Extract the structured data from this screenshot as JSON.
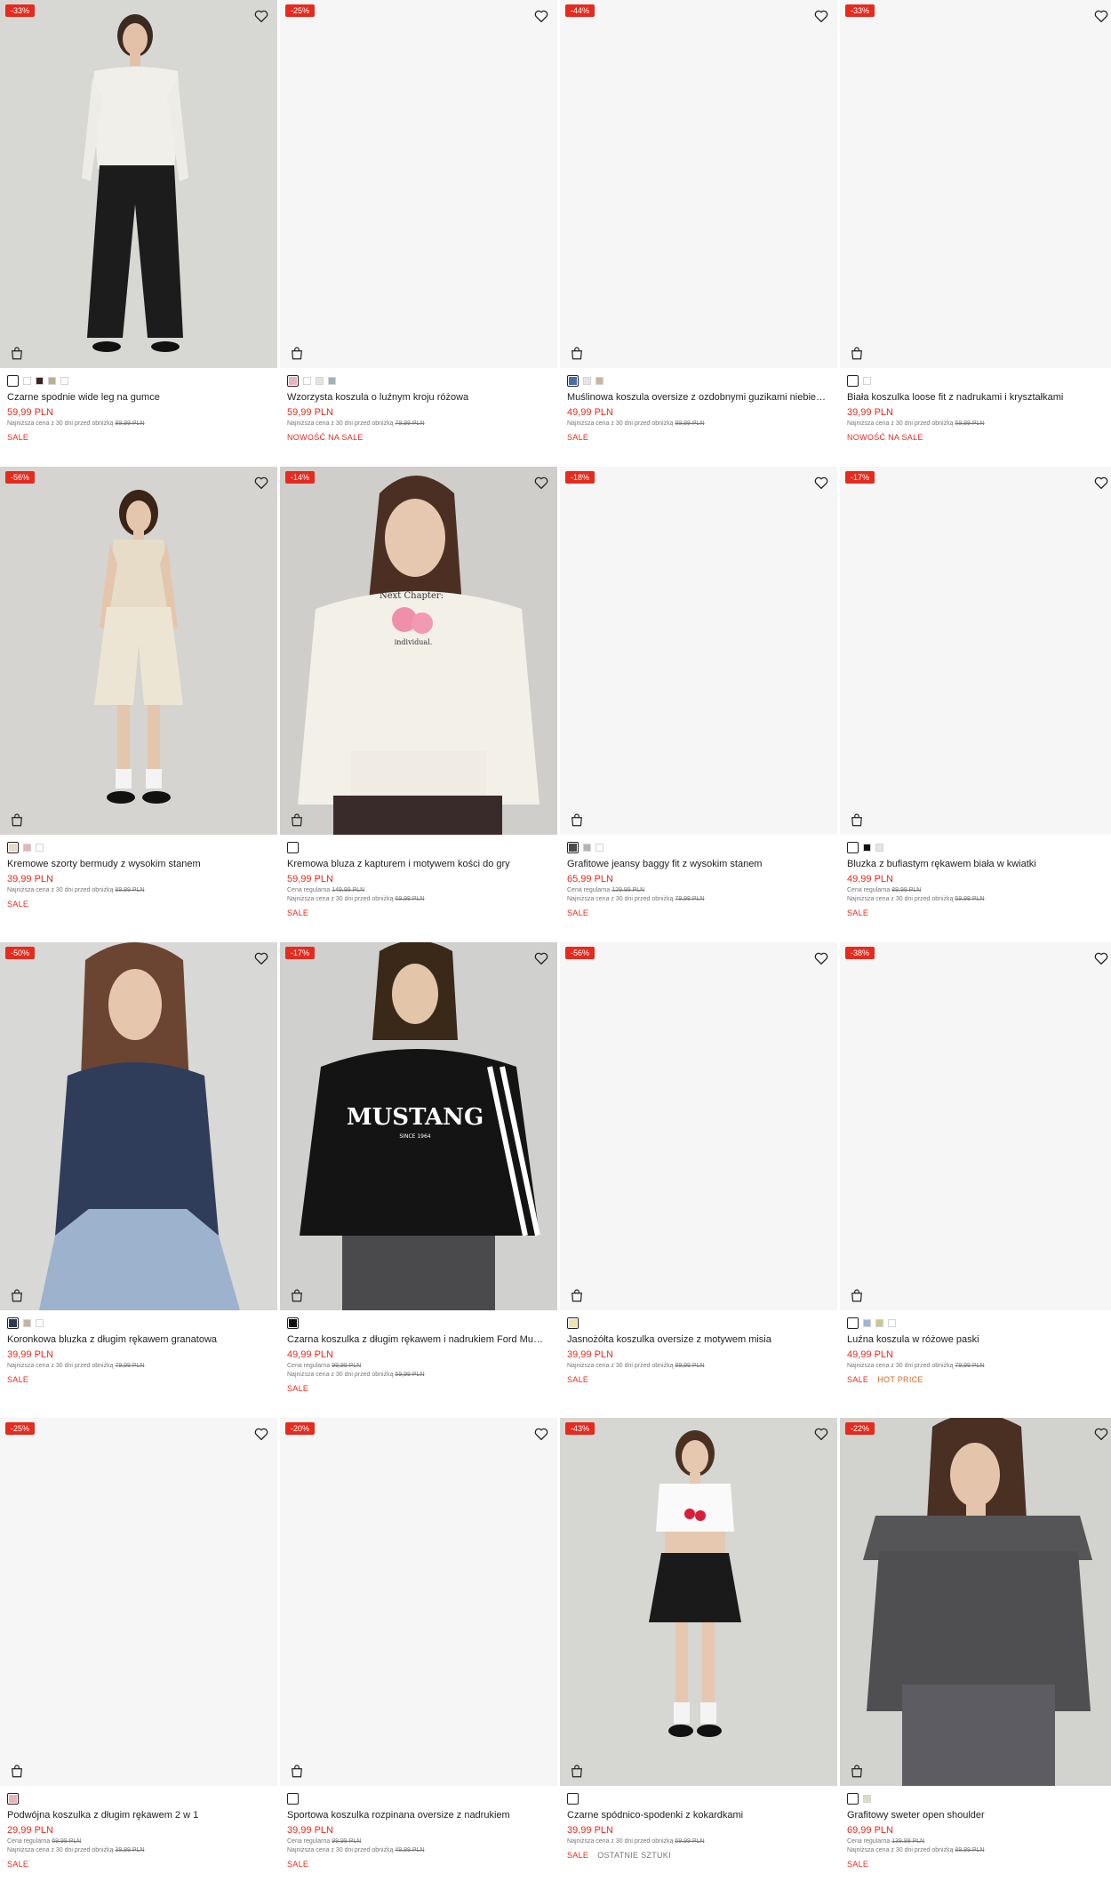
{
  "products": [
    {
      "discount": "-33%",
      "has_photo": true,
      "figure": "offshoulder_white",
      "swatches": [
        "#ffffff",
        "#ffffff",
        "#3a2520",
        "#b8b095",
        "#ffffff"
      ],
      "name": "Czarne spodnie wide leg na gumce",
      "price": "59,99 PLN",
      "regular": "",
      "lowest_label": "Najniższa cena z 30 dni przed obniżką",
      "lowest_price": "89,99 PLN",
      "tags": [
        "SALE"
      ]
    },
    {
      "discount": "-25%",
      "has_photo": false,
      "figure": "",
      "swatches": [
        "#e8b4bc",
        "#ffffff",
        "#e5e5dd",
        "#9ab5b8"
      ],
      "name": "Wzorzysta koszula o luźnym kroju różowa",
      "price": "59,99 PLN",
      "regular": "",
      "lowest_label": "Najniższa cena z 30 dni przed obniżką",
      "lowest_price": "79,99 PLN",
      "tags": [
        "NOWOŚĆ NA SALE"
      ]
    },
    {
      "discount": "-44%",
      "has_photo": false,
      "figure": "",
      "swatches": [
        "#4a6fa8",
        "#e5e5e5",
        "#c9b79a"
      ],
      "name": "Muślinowa koszula oversize z ozdobnymi guzikami niebieska",
      "price": "49,99 PLN",
      "regular": "",
      "lowest_label": "Najniższa cena z 30 dni przed obniżką",
      "lowest_price": "89,99 PLN",
      "tags": [
        "SALE"
      ]
    },
    {
      "discount": "-33%",
      "has_photo": false,
      "figure": "",
      "swatches": [
        "#ffffff",
        "#ffffff"
      ],
      "name": "Biała koszulka loose fit z nadrukami i kryształkami",
      "price": "39,99 PLN",
      "regular": "",
      "lowest_label": "Najniższa cena z 30 dni przed obniżką",
      "lowest_price": "59,99 PLN",
      "tags": [
        "NOWOŚĆ NA SALE"
      ]
    },
    {
      "discount": "-56%",
      "has_photo": true,
      "figure": "cream_set",
      "swatches": [
        "#e3dccb",
        "#e8b4bc",
        "#ffffff"
      ],
      "name": "Kremowe szorty bermudy z wysokim stanem",
      "price": "39,99 PLN",
      "regular": "",
      "lowest_label": "Najniższa cena z 30 dni przed obniżką",
      "lowest_price": "89,99 PLN",
      "tags": [
        "SALE"
      ]
    },
    {
      "discount": "-14%",
      "has_photo": true,
      "figure": "hoodie_cream",
      "swatches": [
        "#ffffff"
      ],
      "name": "Kremowa bluza z kapturem i motywem kości do gry",
      "price": "59,99 PLN",
      "regular": "149,99 PLN",
      "lowest_label": "Najniższa cena z 30 dni przed obniżką",
      "lowest_price": "69,99 PLN",
      "tags": [
        "SALE"
      ]
    },
    {
      "discount": "-18%",
      "has_photo": false,
      "figure": "",
      "swatches": [
        "#4a4a4a",
        "#b5b5b5",
        "#ffffff"
      ],
      "name": "Grafitowe jeansy baggy fit z wysokim stanem",
      "price": "65,99 PLN",
      "regular": "129,99 PLN",
      "lowest_label": "Najniższa cena z 30 dni przed obniżką",
      "lowest_price": "79,99 PLN",
      "tags": [
        "SALE"
      ]
    },
    {
      "discount": "-17%",
      "has_photo": false,
      "figure": "",
      "swatches": [
        "#ffffff",
        "#111111",
        "#e5e5e5"
      ],
      "name": "Bluzka z bufiastym rękawem biała w kwiatki",
      "price": "49,99 PLN",
      "regular": "89,99 PLN",
      "lowest_label": "Najniższa cena z 30 dni przed obniżką",
      "lowest_price": "59,99 PLN",
      "tags": [
        "SALE"
      ]
    },
    {
      "discount": "-50%",
      "has_photo": true,
      "figure": "lace_navy",
      "swatches": [
        "#2c3a55",
        "#c7b29c",
        "#ffffff"
      ],
      "name": "Koronkowa bluzka z długim rękawem granatowa",
      "price": "39,99 PLN",
      "regular": "",
      "lowest_label": "Najniższa cena z 30 dni przed obniżką",
      "lowest_price": "79,99 PLN",
      "tags": [
        "SALE"
      ]
    },
    {
      "discount": "-17%",
      "has_photo": true,
      "figure": "mustang_black",
      "swatches": [
        "#111111"
      ],
      "name": "Czarna koszulka z długim rękawem i nadrukiem Ford Mustang",
      "price": "49,99 PLN",
      "regular": "99,99 PLN",
      "lowest_label": "Najniższa cena z 30 dni przed obniżką",
      "lowest_price": "59,99 PLN",
      "tags": [
        "SALE"
      ]
    },
    {
      "discount": "-56%",
      "has_photo": false,
      "figure": "",
      "swatches": [
        "#efe3b0"
      ],
      "name": "Jasnożółta koszulka oversize z motywem misia",
      "price": "39,99 PLN",
      "regular": "",
      "lowest_label": "Najniższa cena z 30 dni przed obniżką",
      "lowest_price": "89,99 PLN",
      "tags": [
        "SALE"
      ]
    },
    {
      "discount": "-38%",
      "has_photo": false,
      "figure": "",
      "swatches": [
        "#ffffff",
        "#9fb4d9",
        "#c8c890",
        "#ffffff"
      ],
      "name": "Luźna koszula w różowe paski",
      "price": "49,99 PLN",
      "regular": "",
      "lowest_label": "Najniższa cena z 30 dni przed obniżką",
      "lowest_price": "79,99 PLN",
      "tags": [
        "SALE",
        "HOT PRICE"
      ]
    },
    {
      "discount": "-25%",
      "has_photo": false,
      "figure": "",
      "swatches": [
        "#e8b4bc"
      ],
      "name": "Podwójna koszulka z długim rękawem 2 w 1",
      "price": "29,99 PLN",
      "regular": "69,99 PLN",
      "lowest_label": "Najniższa cena z 30 dni przed obniżką",
      "lowest_price": "39,99 PLN",
      "tags": [
        "SALE"
      ]
    },
    {
      "discount": "-20%",
      "has_photo": false,
      "figure": "",
      "swatches": [
        "#ffffff"
      ],
      "name": "Sportowa koszulka rozpinana oversize z nadrukiem",
      "price": "39,99 PLN",
      "regular": "99,99 PLN",
      "lowest_label": "Najniższa cena z 30 dni przed obniżką",
      "lowest_price": "49,99 PLN",
      "tags": [
        "SALE"
      ]
    },
    {
      "discount": "-43%",
      "has_photo": true,
      "figure": "cherry_skirt",
      "swatches": [
        "#ffffff"
      ],
      "name": "Czarne spódnico-spodenki z kokardkami",
      "price": "39,99 PLN",
      "regular": "",
      "lowest_label": "Najniższa cena z 30 dni przed obniżką",
      "lowest_price": "69,99 PLN",
      "tags": [
        "SALE",
        "OSTATNIE SZTUKI"
      ]
    },
    {
      "discount": "-22%",
      "has_photo": true,
      "figure": "sweater_grey",
      "swatches": [
        "#ffffff",
        "#dcdcc4"
      ],
      "name": "Grafitowy sweter open shoulder",
      "price": "69,99 PLN",
      "regular": "139,99 PLN",
      "lowest_label": "Najniższa cena z 30 dni przed obniżką",
      "lowest_price": "89,99 PLN",
      "tags": [
        "SALE"
      ]
    }
  ],
  "labels": {
    "regular_prefix": "Cena regularna"
  }
}
